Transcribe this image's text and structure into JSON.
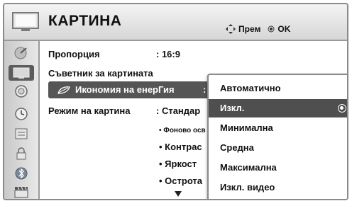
{
  "header": {
    "title": "КАРТИНА",
    "hint_move": "Прем",
    "hint_ok": "OK"
  },
  "sidebar": {
    "items": [
      {
        "icon": "satellite-dish-icon"
      },
      {
        "icon": "picture-icon",
        "active": true
      },
      {
        "icon": "speaker-icon"
      },
      {
        "icon": "clock-icon"
      },
      {
        "icon": "option-box-icon"
      },
      {
        "icon": "lock-icon"
      },
      {
        "icon": "bluetooth-icon"
      },
      {
        "icon": "clapper-icon"
      }
    ]
  },
  "menu": {
    "aspect_label": "Пропорция",
    "aspect_value": ": 16:9",
    "wizard_label": "Съветник за картината",
    "energy_label": "Икономия на енерГия",
    "energy_colon": ":",
    "picture_mode_label": "Режим на картина",
    "picture_mode_value": ": Стандар",
    "sub_items": [
      "• Фоново осв",
      "• Контрас",
      "• Яркост",
      "• Острота"
    ]
  },
  "dropdown": {
    "options": [
      {
        "label": "Автоматично",
        "selected": false
      },
      {
        "label": "Изкл.",
        "selected": true
      },
      {
        "label": "Минимална",
        "selected": false
      },
      {
        "label": "Средна",
        "selected": false
      },
      {
        "label": "Максимална",
        "selected": false
      },
      {
        "label": "Изкл. видео",
        "selected": false
      }
    ]
  }
}
